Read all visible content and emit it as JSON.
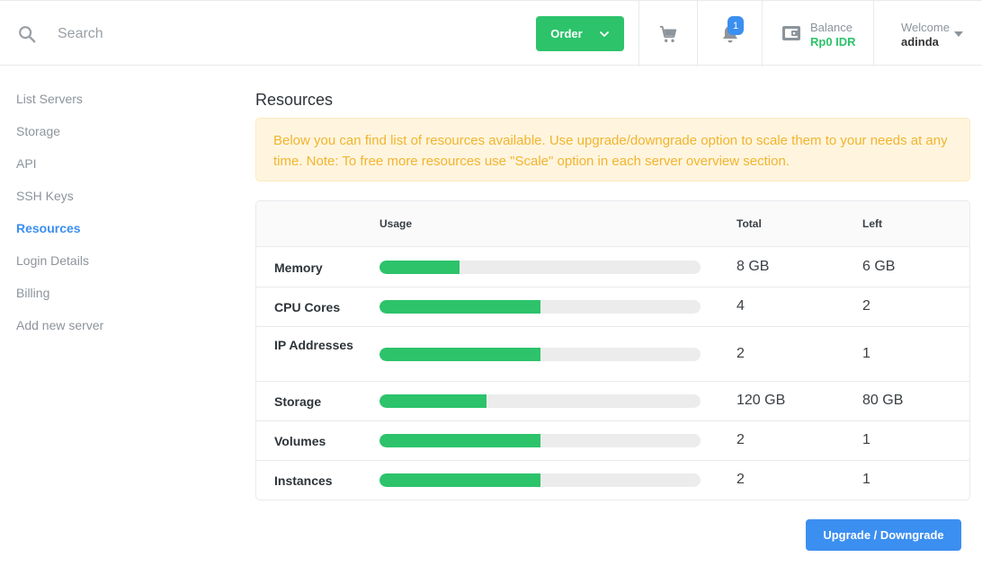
{
  "header": {
    "search_placeholder": "Search",
    "order_label": "Order",
    "notifications_count": "1",
    "balance_label": "Balance",
    "balance_value": "Rp0 IDR",
    "welcome_label": "Welcome",
    "user_name": "adinda"
  },
  "sidebar": {
    "items": [
      {
        "label": "List Servers",
        "active": false
      },
      {
        "label": "Storage",
        "active": false
      },
      {
        "label": "API",
        "active": false
      },
      {
        "label": "SSH Keys",
        "active": false
      },
      {
        "label": "Resources",
        "active": true
      },
      {
        "label": "Login Details",
        "active": false
      },
      {
        "label": "Billing",
        "active": false
      },
      {
        "label": "Add new server",
        "active": false
      }
    ]
  },
  "main": {
    "title": "Resources",
    "alert": "Below you can find list of resources available. Use upgrade/downgrade option to scale them to your needs at any time. Note: To free more resources use \"Scale\" option in each server overview section.",
    "table": {
      "headers": {
        "usage": "Usage",
        "total": "Total",
        "left": "Left"
      },
      "rows": [
        {
          "name": "Memory",
          "usage": 0.25,
          "total": "8 GB",
          "left": "6 GB"
        },
        {
          "name": "CPU Cores",
          "usage": 0.5,
          "total": "4",
          "left": "2"
        },
        {
          "name": "IP Addresses",
          "usage": 0.5,
          "total": "2",
          "left": "1"
        },
        {
          "name": "Storage",
          "usage": 0.333,
          "total": "120 GB",
          "left": "80 GB"
        },
        {
          "name": "Volumes",
          "usage": 0.5,
          "total": "2",
          "left": "1"
        },
        {
          "name": "Instances",
          "usage": 0.5,
          "total": "2",
          "left": "1"
        }
      ]
    },
    "upgrade_label": "Upgrade / Downgrade"
  },
  "colors": {
    "accent_green": "#2cc36b",
    "accent_blue": "#3b8ff0",
    "alert_text": "#f1b42f"
  },
  "icons": {
    "search": "search-icon",
    "cart": "cart-icon",
    "bell": "bell-icon",
    "wallet": "wallet-icon",
    "chevron": "chevron-down-icon"
  }
}
